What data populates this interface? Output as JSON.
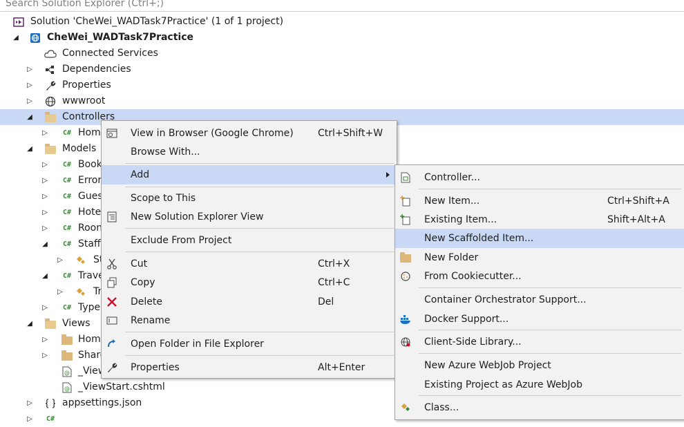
{
  "search": {
    "placeholder": "Search Solution Explorer (Ctrl+;)"
  },
  "tree": {
    "rows": [
      {
        "label": "Solution 'CheWei_WADTask7Practice' (1 of 1 project)",
        "icon": "solution-icon"
      },
      {
        "label": "CheWei_WADTask7Practice",
        "icon": "web-project-icon"
      },
      {
        "label": "Connected Services",
        "icon": "cloud-icon"
      },
      {
        "label": "Dependencies",
        "icon": "dependencies-icon"
      },
      {
        "label": "Properties",
        "icon": "wrench-icon"
      },
      {
        "label": "wwwroot",
        "icon": "globe-icon"
      },
      {
        "label": "Controllers",
        "icon": "folder-icon"
      },
      {
        "label": "Hom",
        "icon": "csharp-icon"
      },
      {
        "label": "Models",
        "icon": "folder-icon"
      },
      {
        "label": "Book",
        "icon": "csharp-icon"
      },
      {
        "label": "Error",
        "icon": "csharp-icon"
      },
      {
        "label": "Gues",
        "icon": "csharp-icon"
      },
      {
        "label": "Hote",
        "icon": "csharp-icon"
      },
      {
        "label": "Roon",
        "icon": "csharp-icon"
      },
      {
        "label": "Staff",
        "icon": "csharp-icon"
      },
      {
        "label": "St",
        "icon": "class-icon"
      },
      {
        "label": "Trave",
        "icon": "csharp-icon"
      },
      {
        "label": "Tr",
        "icon": "class-icon"
      },
      {
        "label": "Type",
        "icon": "csharp-icon"
      },
      {
        "label": "Views",
        "icon": "folder-icon"
      },
      {
        "label": "Hom",
        "icon": "folder-icon"
      },
      {
        "label": "Share",
        "icon": "folder-icon"
      },
      {
        "label": "_View",
        "icon": "razor-icon"
      },
      {
        "label": "_ViewStart.cshtml",
        "icon": "razor-icon"
      },
      {
        "label": "appsettings.json",
        "icon": "json-icon"
      }
    ]
  },
  "context_menu": {
    "items": [
      {
        "label": "View in Browser (Google Chrome)",
        "shortcut": "Ctrl+Shift+W"
      },
      {
        "label": "Browse With...",
        "shortcut": ""
      },
      {
        "label": "Add",
        "shortcut": ""
      },
      {
        "label": "Scope to This",
        "shortcut": ""
      },
      {
        "label": "New Solution Explorer View",
        "shortcut": ""
      },
      {
        "label": "Exclude From Project",
        "shortcut": ""
      },
      {
        "label": "Cut",
        "shortcut": "Ctrl+X"
      },
      {
        "label": "Copy",
        "shortcut": "Ctrl+C"
      },
      {
        "label": "Delete",
        "shortcut": "Del"
      },
      {
        "label": "Rename",
        "shortcut": ""
      },
      {
        "label": "Open Folder in File Explorer",
        "shortcut": ""
      },
      {
        "label": "Properties",
        "shortcut": "Alt+Enter"
      }
    ]
  },
  "add_submenu": {
    "items": [
      {
        "label": "Controller...",
        "shortcut": ""
      },
      {
        "label": "New Item...",
        "shortcut": "Ctrl+Shift+A"
      },
      {
        "label": "Existing Item...",
        "shortcut": "Shift+Alt+A"
      },
      {
        "label": "New Scaffolded Item...",
        "shortcut": ""
      },
      {
        "label": "New Folder",
        "shortcut": ""
      },
      {
        "label": "From Cookiecutter...",
        "shortcut": ""
      },
      {
        "label": "Container Orchestrator Support...",
        "shortcut": ""
      },
      {
        "label": "Docker Support...",
        "shortcut": ""
      },
      {
        "label": "Client-Side Library...",
        "shortcut": ""
      },
      {
        "label": "New Azure WebJob Project",
        "shortcut": ""
      },
      {
        "label": "Existing Project as Azure WebJob",
        "shortcut": ""
      },
      {
        "label": "Class...",
        "shortcut": ""
      }
    ]
  },
  "colors": {
    "selection": "#c9d9f5",
    "menu_background": "#f2f2f2",
    "csharp_green": "#388a34",
    "folder_tan": "#dcb67a",
    "delete_red": "#c8102e"
  }
}
